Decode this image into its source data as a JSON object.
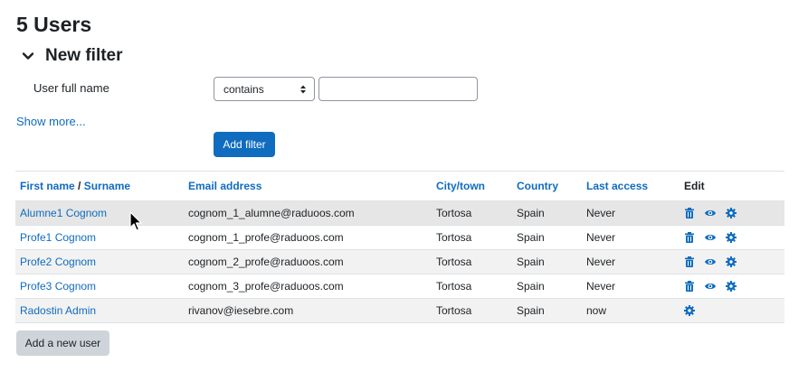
{
  "page": {
    "title": "5 Users"
  },
  "filter": {
    "title": "New filter",
    "field_label": "User full name",
    "operator": "contains",
    "value": "",
    "show_more": "Show more...",
    "add_filter": "Add filter"
  },
  "table": {
    "headers": {
      "firstname": "First name",
      "separator": " / ",
      "surname": "Surname",
      "email": "Email address",
      "city": "City/town",
      "country": "Country",
      "last_access": "Last access",
      "edit": "Edit"
    },
    "rows": [
      {
        "name": "Alumne1 Cognom",
        "email": "cognom_1_alumne@raduoos.com",
        "city": "Tortosa",
        "country": "Spain",
        "last_access": "Never",
        "actions": [
          "delete-icon",
          "view-icon",
          "settings-icon"
        ]
      },
      {
        "name": "Profe1 Cognom",
        "email": "cognom_1_profe@raduoos.com",
        "city": "Tortosa",
        "country": "Spain",
        "last_access": "Never",
        "actions": [
          "delete-icon",
          "view-icon",
          "settings-icon"
        ]
      },
      {
        "name": "Profe2 Cognom",
        "email": "cognom_2_profe@raduoos.com",
        "city": "Tortosa",
        "country": "Spain",
        "last_access": "Never",
        "actions": [
          "delete-icon",
          "view-icon",
          "settings-icon"
        ]
      },
      {
        "name": "Profe3 Cognom",
        "email": "cognom_3_profe@raduoos.com",
        "city": "Tortosa",
        "country": "Spain",
        "last_access": "Never",
        "actions": [
          "delete-icon",
          "view-icon",
          "settings-icon"
        ]
      },
      {
        "name": "Radostin Admin",
        "email": "rivanov@iesebre.com",
        "city": "Tortosa",
        "country": "Spain",
        "last_access": "now",
        "actions": [
          "settings-icon"
        ]
      }
    ]
  },
  "add_user_button": "Add a new user",
  "colors": {
    "link": "#0f6cbf",
    "primary": "#0f6cbf",
    "secondary": "#ced4da",
    "row_stripe": "#f2f2f2"
  }
}
